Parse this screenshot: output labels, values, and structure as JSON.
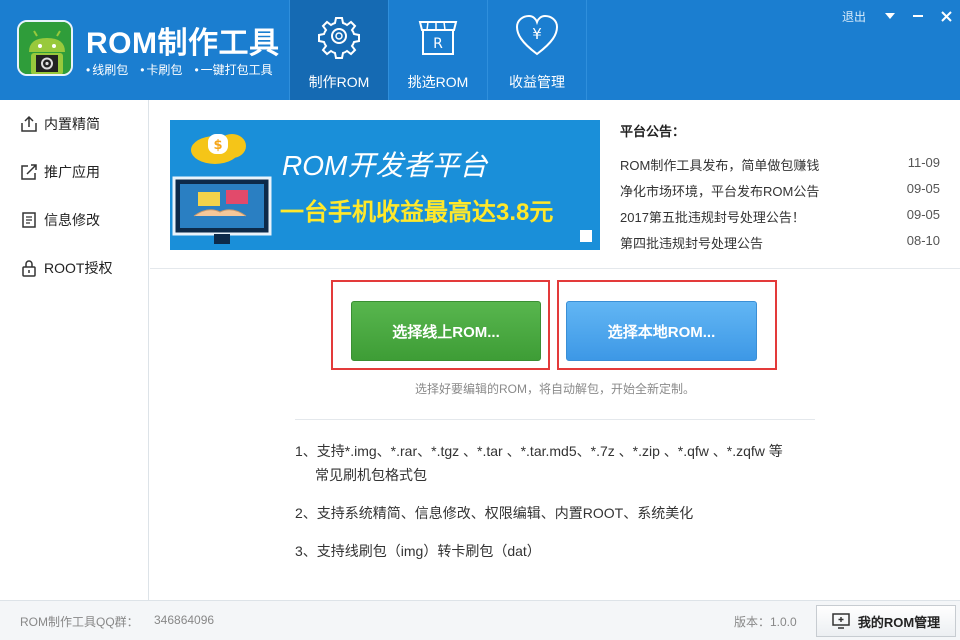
{
  "header": {
    "title": "ROM制作工具",
    "subtitle": [
      "线刷包",
      "卡刷包",
      "一键打包工具"
    ],
    "tabs": [
      {
        "label": "制作ROM",
        "icon": "gear-icon",
        "active": true
      },
      {
        "label": "挑选ROM",
        "icon": "store-icon",
        "active": false
      },
      {
        "label": "收益管理",
        "icon": "heart-yen-icon",
        "active": false
      }
    ],
    "logout": "退出",
    "colors": {
      "header_bg": "#1b7ed0",
      "active_tab": "#156ab3"
    }
  },
  "sidebar": {
    "items": [
      {
        "label": "内置精简",
        "icon": "upload-box-icon"
      },
      {
        "label": "推广应用",
        "icon": "share-box-icon"
      },
      {
        "label": "信息修改",
        "icon": "document-icon"
      },
      {
        "label": "ROOT授权",
        "icon": "lock-icon"
      }
    ]
  },
  "banner": {
    "title": "ROM开发者平台",
    "subtitle": "一台手机收益最高达3.8元"
  },
  "notices": {
    "title": "平台公告：",
    "items": [
      {
        "text": "ROM制作工具发布，简单做包赚钱",
        "date": "11-09"
      },
      {
        "text": "净化市场环境，平台发布ROM公告",
        "date": "09-05"
      },
      {
        "text": "2017第五批违规封号处理公告！",
        "date": "09-05"
      },
      {
        "text": "第四批违规封号处理公告",
        "date": "08-10"
      }
    ]
  },
  "actions": {
    "online_button": "选择线上ROM...",
    "local_button": "选择本地ROM...",
    "hint": "选择好要编辑的ROM，将自动解包，开始全新定制。",
    "colors": {
      "online": "#4caf43",
      "local": "#4aa6ee",
      "outline": "#e33a3a"
    }
  },
  "features": {
    "line1a": "1、支持*.img、*.rar、*.tgz 、*.tar 、*.tar.md5、*.7z 、*.zip 、*.qfw 、*.zqfw 等",
    "line1b": "常见刷机包格式包",
    "line2": "2、支持系统精简、信息修改、权限编辑、内置ROOT、系统美化",
    "line3": "3、支持线刷包（img）转卡刷包（dat）"
  },
  "footer": {
    "qq_label": "ROM制作工具QQ群：",
    "qq_number": "346864096",
    "version": "版本：1.0.0",
    "my_rom_button": "我的ROM管理"
  }
}
